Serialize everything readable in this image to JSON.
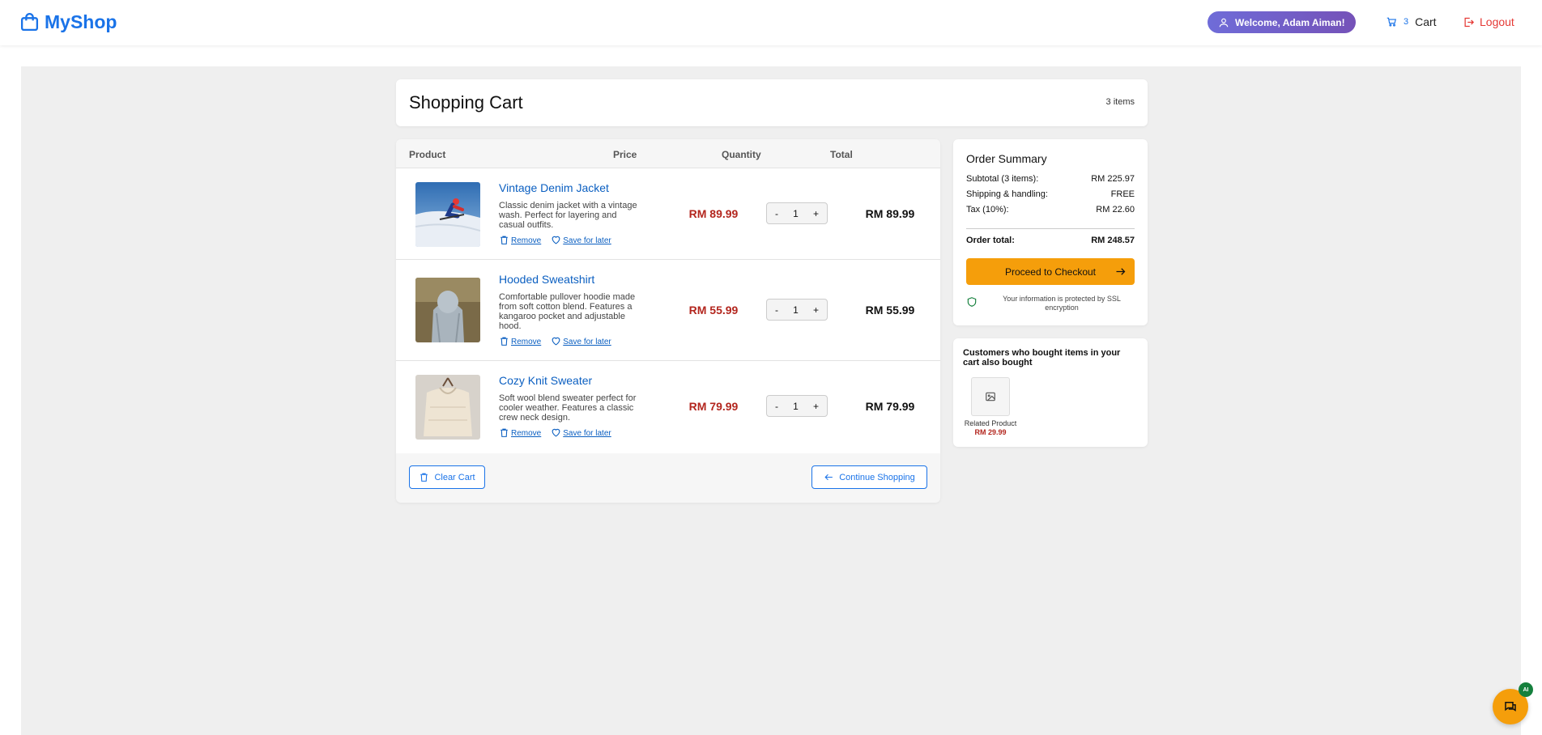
{
  "header": {
    "brand": "MyShop",
    "welcome": "Welcome, Adam Aiman!",
    "cart_count": "3",
    "cart_label": "Cart",
    "logout_label": "Logout"
  },
  "cart": {
    "title": "Shopping Cart",
    "item_count": "3 items",
    "columns": [
      "Product",
      "Price",
      "Quantity",
      "Total"
    ],
    "items": [
      {
        "name": "Vintage Denim Jacket",
        "description": "Classic denim jacket with a vintage wash. Perfect for layering and casual outfits.",
        "price": "RM 89.99",
        "quantity": "1",
        "total": "RM 89.99",
        "image_icon": "skier-photo"
      },
      {
        "name": "Hooded Sweatshirt",
        "description": "Comfortable pullover hoodie made from soft cotton blend. Features a kangaroo pocket and adjustable hood.",
        "price": "RM 55.99",
        "quantity": "1",
        "total": "RM 55.99",
        "image_icon": "hoodie-photo"
      },
      {
        "name": "Cozy Knit Sweater",
        "description": "Soft wool blend sweater perfect for cooler weather. Features a classic crew neck design.",
        "price": "RM 79.99",
        "quantity": "1",
        "total": "RM 79.99",
        "image_icon": "sweater-photo"
      }
    ],
    "remove_label": "Remove",
    "save_label": "Save for later",
    "minus": "-",
    "plus": "+",
    "clear_label": "Clear Cart",
    "continue_label": "Continue Shopping"
  },
  "summary": {
    "title": "Order Summary",
    "subtotal_label": "Subtotal (3 items):",
    "subtotal_value": "RM 225.97",
    "shipping_label": "Shipping & handling:",
    "shipping_value": "FREE",
    "tax_label": "Tax (10%):",
    "tax_value": "RM 22.60",
    "total_label": "Order total:",
    "total_value": "RM 248.57",
    "checkout_label": "Proceed to Checkout",
    "ssl_text": "Your information is protected by SSL encryption"
  },
  "related": {
    "title": "Customers who bought items in your cart also bought",
    "product_name": "Related Product",
    "product_price": "RM 29.99"
  },
  "chat": {
    "badge": "AI"
  },
  "colors": {
    "brand": "#1a73e8",
    "price": "#b3261e",
    "checkout": "#f59e0b",
    "logout": "#e53935",
    "badge": "#15803d"
  }
}
